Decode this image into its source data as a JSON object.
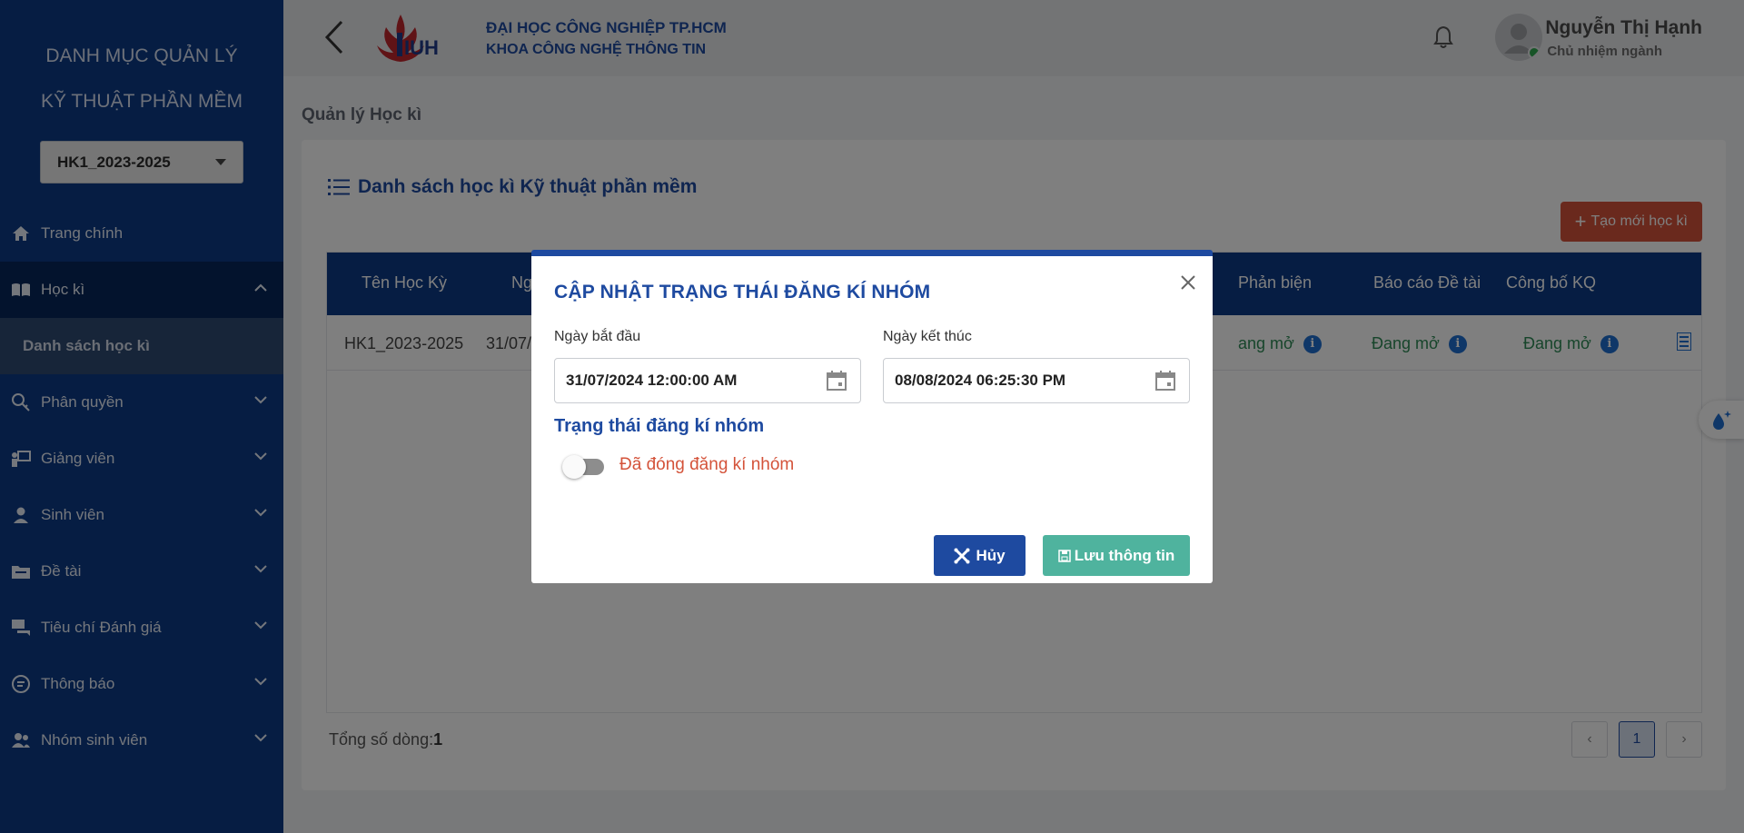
{
  "sidebar": {
    "title_line1": "DANH MỤC QUẢN LÝ",
    "title_line2": "KỸ THUẬT PHẦN MỀM",
    "semester_select": "HK1_2023-2025",
    "items": [
      {
        "label": "Trang chính",
        "icon": "home-icon"
      },
      {
        "label": "Học kì",
        "icon": "book-icon"
      },
      {
        "label": "Danh sách học kì"
      },
      {
        "label": "Phân quyền",
        "icon": "key-icon"
      },
      {
        "label": "Giảng viên",
        "icon": "teacher-icon"
      },
      {
        "label": "Sinh viên",
        "icon": "student-icon"
      },
      {
        "label": "Đề tài",
        "icon": "folder-icon"
      },
      {
        "label": "Tiêu chí Đánh giá",
        "icon": "chat-icon"
      },
      {
        "label": "Thông báo",
        "icon": "message-icon"
      },
      {
        "label": "Nhóm sinh viên",
        "icon": "group-icon"
      }
    ]
  },
  "header": {
    "university": "ĐẠI HỌC CÔNG NGHIỆP TP.HCM",
    "faculty": "KHOA CÔNG NGHỆ THÔNG TIN",
    "logo_text": "IUH",
    "user_name": "Nguyễn Thị Hạnh",
    "user_role": "Chủ nhiệm ngành"
  },
  "page": {
    "breadcrumb": "Quản lý Học kì",
    "card_title": "Danh sách học kì Kỹ thuật phần mềm",
    "add_button": "Tạo mới học kì"
  },
  "table": {
    "headers": [
      "Tên Học Kỳ",
      "Ng",
      "Phản biện",
      "Báo cáo Đề tài",
      "Công bố KQ"
    ],
    "row": {
      "name": "HK1_2023-2025",
      "date_partial": "31/07/",
      "review": "ang mở",
      "report": "Đang mở",
      "publish": "Đang mở"
    },
    "total_label": "Tổng số dòng:",
    "total_value": "1",
    "page": "1"
  },
  "modal": {
    "title": "CẬP NHẬT TRẠNG THÁI ĐĂNG KÍ NHÓM",
    "start_label": "Ngày bắt đầu",
    "start_value": "31/07/2024 12:00:00 AM",
    "end_label": "Ngày kết thúc",
    "end_value": "08/08/2024 06:25:30 PM",
    "section_label": "Trạng thái đăng kí nhóm",
    "toggle_label": "Đã đóng đăng kí nhóm",
    "toggle_on": false,
    "cancel_button": "Hủy",
    "save_button": "Lưu thông tin"
  },
  "colors": {
    "primary": "#1e4aa0",
    "sidebar": "#0c3a86",
    "danger": "#d4533a",
    "success": "#4fb39e",
    "status_open": "#2e8b57"
  }
}
